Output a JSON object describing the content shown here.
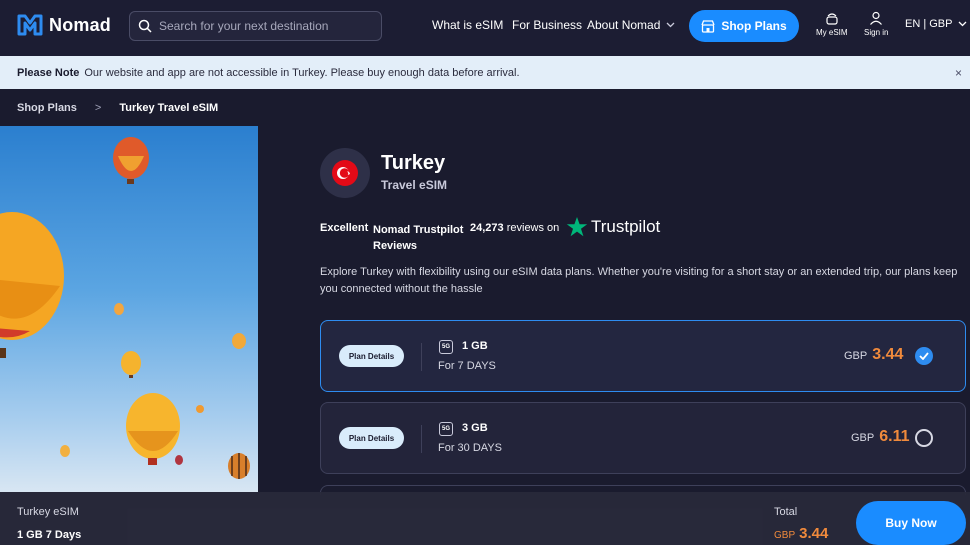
{
  "header": {
    "logo_text": "Nomad",
    "search_placeholder": "Search for your next destination",
    "nav": {
      "what_is_esim": "What is eSIM",
      "for_business": "For Business",
      "about_nomad": "About Nomad"
    },
    "shop_plans": "Shop Plans",
    "my_esim": "My eSIM",
    "sign_in": "Sign in",
    "locale": "EN | GBP"
  },
  "notice": {
    "label": "Please Note",
    "text": "Our website and app are not accessible in Turkey. Please buy enough data before arrival.",
    "close": "×"
  },
  "breadcrumb": {
    "parent": "Shop Plans",
    "separator": ">",
    "current": "Turkey Travel eSIM"
  },
  "product": {
    "country": "Turkey",
    "type": "Travel eSIM",
    "rating_word": "Excellent",
    "rating_source": "Nomad Trustpilot Reviews",
    "review_count": "24,273",
    "reviews_on": "reviews on",
    "trustpilot": "Trustpilot",
    "description": "Explore Turkey with flexibility using our eSIM data plans. Whether you're visiting for a short stay or an extended trip, our plans keep you connected without the hassle"
  },
  "plans": [
    {
      "details_label": "Plan Details",
      "network": "5G",
      "size": "1 GB",
      "duration": "For 7 DAYS",
      "currency": "GBP",
      "price": "3.44",
      "selected": true
    },
    {
      "details_label": "Plan Details",
      "network": "5G",
      "size": "3 GB",
      "duration": "For 30 DAYS",
      "currency": "GBP",
      "price": "6.11",
      "selected": false
    }
  ],
  "bottom_bar": {
    "product_name": "Turkey eSIM",
    "selected_plan": "1 GB 7 Days",
    "total_label": "Total",
    "currency": "GBP",
    "total": "3.44",
    "buy_now": "Buy Now"
  },
  "colors": {
    "background": "#1a1b2e",
    "accent": "#1a8cff",
    "price": "#f08a3c",
    "notice_bg": "#e3eef9"
  }
}
